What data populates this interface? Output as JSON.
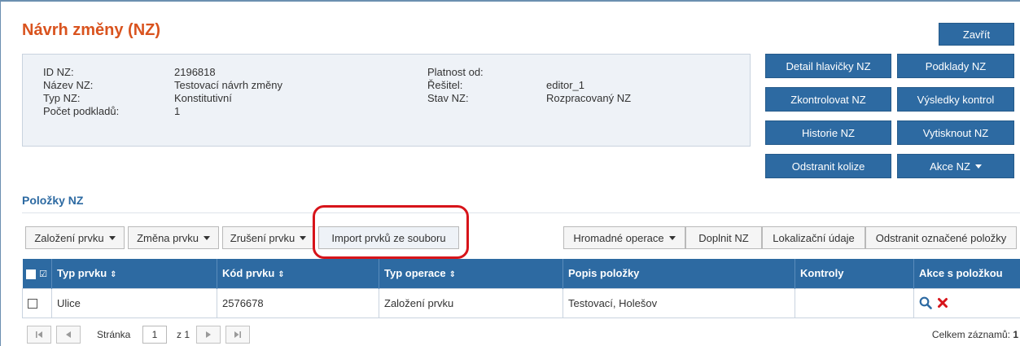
{
  "page": {
    "title": "Návrh změny (NZ)",
    "close_label": "Zavřít"
  },
  "info": {
    "id_label": "ID NZ:",
    "id_value": "2196818",
    "name_label": "Název NZ:",
    "name_value": "Testovací návrh změny",
    "type_label": "Typ NZ:",
    "type_value": "Konstitutivní",
    "count_label": "Počet podkladů:",
    "count_value": "1",
    "validity_label": "Platnost od:",
    "validity_value": "",
    "solver_label": "Řešitel:",
    "solver_value": "editor_1",
    "state_label": "Stav NZ:",
    "state_value": "Rozpracovaný NZ"
  },
  "actions": {
    "detail": "Detail hlavičky NZ",
    "docs": "Podklady NZ",
    "check": "Zkontrolovat NZ",
    "results": "Výsledky kontrol",
    "history": "Historie NZ",
    "print": "Vytisknout NZ",
    "remove_collisions": "Odstranit kolize",
    "actions_menu": "Akce NZ"
  },
  "items": {
    "section_title": "Položky NZ",
    "toolbar": {
      "create": "Založení prvku",
      "change": "Změna prvku",
      "cancel": "Zrušení prvku",
      "import": "Import prvků ze souboru",
      "bulk": "Hromadné operace",
      "complete": "Doplnit NZ",
      "localization": "Lokalizační údaje",
      "remove_selected": "Odstranit označené položky"
    },
    "columns": {
      "type": "Typ prvku",
      "code": "Kód prvku",
      "operation": "Typ operace",
      "description": "Popis položky",
      "checks": "Kontroly",
      "row_actions": "Akce s položkou"
    },
    "rows": [
      {
        "type": "Ulice",
        "code": "2576678",
        "operation": "Založení prvku",
        "description": "Testovací, Holešov",
        "checks": ""
      }
    ]
  },
  "pager": {
    "page_label": "Stránka",
    "page_value": "1",
    "of_label": "z 1",
    "total_label": "Celkem záznamů:",
    "total_value": "1"
  },
  "colors": {
    "accent": "#2d6aa2",
    "title": "#d9531e",
    "highlight": "#d7141a",
    "delete": "#d7141a"
  }
}
